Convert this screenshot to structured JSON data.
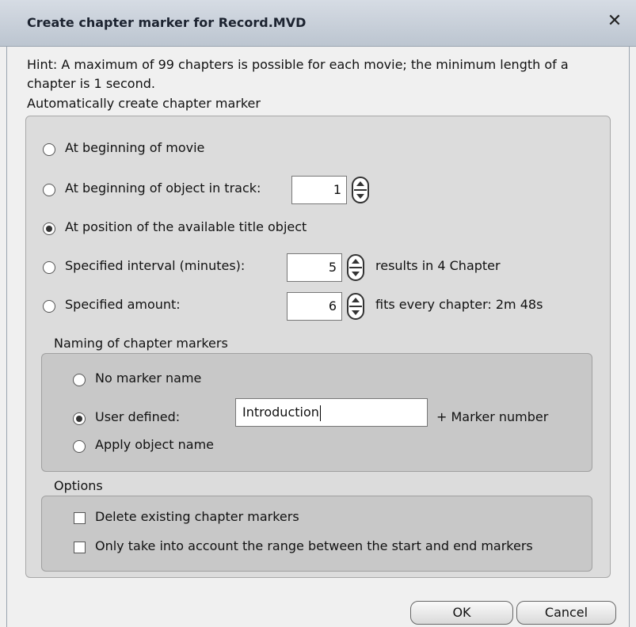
{
  "window": {
    "title": "Create chapter marker for Record.MVD",
    "close_glyph": "✕"
  },
  "hint": "Hint: A maximum of 99 chapters is possible for each movie; the minimum length of a chapter is 1 second.",
  "auto": {
    "label": "Automatically create chapter marker",
    "options": {
      "movie_start": "At beginning of movie",
      "object_start": "At beginning of object in track:",
      "title_object": "At position of the available title object",
      "interval": "Specified interval (minutes):",
      "amount": "Specified amount:"
    },
    "selected": "title_object",
    "object_track_value": "1",
    "interval_value": "5",
    "interval_result": "results in 4 Chapter",
    "amount_value": "6",
    "amount_result": "fits every chapter: 2m 48s"
  },
  "naming": {
    "label": "Naming of chapter markers",
    "options": {
      "none": "No marker name",
      "user": "User defined:",
      "object": "Apply object name"
    },
    "selected": "user",
    "user_value": "Introduction",
    "suffix": "+ Marker number"
  },
  "options": {
    "label": "Options",
    "delete_existing": "Delete existing chapter markers",
    "delete_existing_checked": false,
    "range_only": "Only take into account the range between the start and end markers",
    "range_only_checked": false
  },
  "buttons": {
    "ok": "OK",
    "cancel": "Cancel"
  },
  "icons": {
    "close": "close-icon",
    "spin": "spinner-updown-icon"
  },
  "colors": {
    "titlebar": "#c8d0da",
    "panel": "#dcdcdc",
    "subpanel": "#c8c8c8"
  }
}
